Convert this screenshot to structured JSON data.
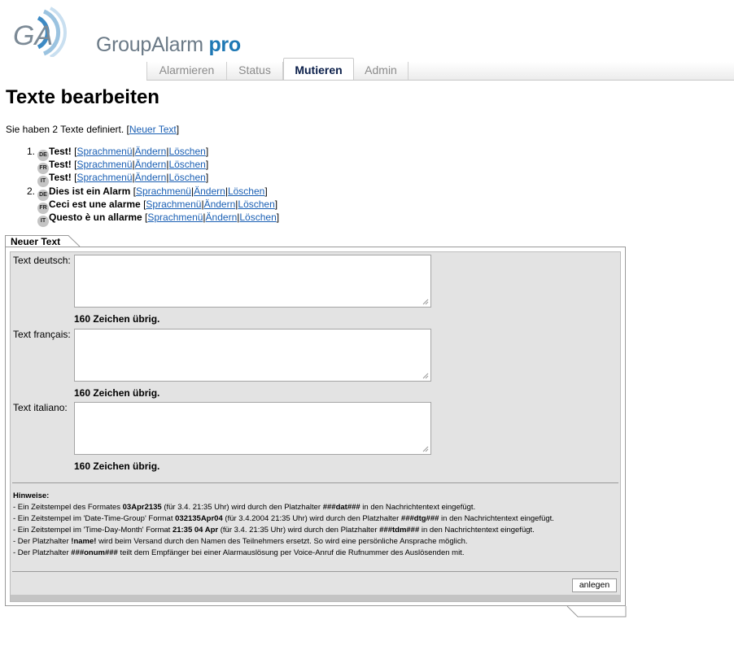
{
  "brand": {
    "name": "GroupAlarm",
    "suffix": "pro",
    "mark": "GA"
  },
  "nav": {
    "tabs": [
      {
        "label": "Alarmieren"
      },
      {
        "label": "Status"
      },
      {
        "label": "Mutieren"
      },
      {
        "label": "Admin"
      }
    ]
  },
  "page": {
    "title": "Texte bearbeiten",
    "summary": "Sie haben 2 Texte definiert. [",
    "new_link": "Neuer Text",
    "summary_end": "]"
  },
  "actions": {
    "lang_menu": "Sprachmenü",
    "edit": "Ändern",
    "delete": "Löschen"
  },
  "texts": [
    {
      "number": "1.",
      "entries": [
        {
          "lang": "DE",
          "text": "Test!"
        },
        {
          "lang": "FR",
          "text": "Test!"
        },
        {
          "lang": "IT",
          "text": "Test!"
        }
      ]
    },
    {
      "number": "2.",
      "entries": [
        {
          "lang": "DE",
          "text": "Dies ist ein Alarm"
        },
        {
          "lang": "FR",
          "text": "Ceci est une alarme"
        },
        {
          "lang": "IT",
          "text": "Questo è un allarme"
        }
      ]
    }
  ],
  "form": {
    "tab_label": "Neuer Text",
    "fields": [
      {
        "label": "Text deutsch:",
        "value": "",
        "remaining": "160 Zeichen übrig."
      },
      {
        "label": "Text français:",
        "value": "",
        "remaining": "160 Zeichen übrig."
      },
      {
        "label": "Text italiano:",
        "value": "",
        "remaining": "160 Zeichen übrig."
      }
    ],
    "hints_title": "Hinweise:",
    "hints": [
      [
        "- Ein Zeitstempel des Formates ",
        "03Apr2135",
        " (für 3.4. 21:35 Uhr) wird durch den Platzhalter ",
        "###dat###",
        " in den Nachrichtentext eingefügt."
      ],
      [
        "- Ein Zeitstempel im 'Date-Time-Group' Format ",
        "032135Apr04",
        " (für 3.4.2004 21:35 Uhr) wird durch den Platzhalter ",
        "###dtg###",
        " in den Nachrichtentext eingefügt."
      ],
      [
        "- Ein Zeitstempel im 'Time-Day-Month' Format ",
        "21:35 04 Apr",
        " (für 3.4. 21:35 Uhr) wird durch den Platzhalter ",
        "###tdm###",
        " in den Nachrichtentext eingefügt."
      ],
      [
        "- Der Platzhalter ",
        "!name!",
        " wird beim Versand durch den Namen des Teilnehmers ersetzt. So wird eine persönliche Ansprache möglich.",
        "",
        ""
      ],
      [
        "- Der Platzhalter ",
        "###onum###",
        " teilt dem Empfänger bei einer Alarmauslösung per Voice-Anruf die Rufnummer des Auslösenden mit.",
        "",
        ""
      ]
    ],
    "submit_label": "anlegen"
  },
  "colors": {
    "link": "#1a5fb4",
    "brand_blue": "#1f78b4",
    "brand_grey": "#6b7a87",
    "panel_bg": "#e3e3e3"
  }
}
